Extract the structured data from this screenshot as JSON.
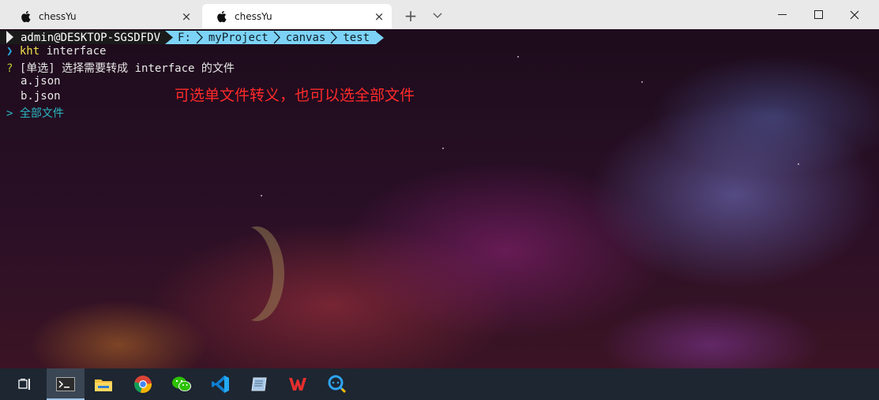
{
  "tabs": [
    {
      "title": "chessYu",
      "close": "×",
      "active": false
    },
    {
      "title": "chessYu",
      "close": "×",
      "active": true
    }
  ],
  "tabbar": {
    "new_tab": "+"
  },
  "prompt": {
    "user": "admin@DESKTOP-SGSDFDV",
    "path": [
      "F:",
      "myProject",
      "canvas",
      "test"
    ]
  },
  "terminal": {
    "command_prefix": "❯",
    "command_name": "kht",
    "command_arg": " interface",
    "question_mark": "?",
    "question": " [单选] 选择需要转成 interface 的文件",
    "options": [
      "a.json",
      "b.json"
    ],
    "selected_marker": ">",
    "selected_option": " 全部文件"
  },
  "annotation": "可选单文件转义，也可以选全部文件",
  "taskbar": {
    "items": [
      "task-view-icon",
      "terminal-icon",
      "file-explorer-icon",
      "chrome-icon",
      "wechat-icon",
      "vscode-icon",
      "notes-app-icon",
      "wps-icon",
      "search-app-icon"
    ],
    "active": "terminal-icon"
  },
  "colors": {
    "prompt_path_bg": "#7cd3f7",
    "annotation": "#ff2a2a",
    "command": "#f0e04a",
    "selected_option": "#2ab7c4"
  }
}
